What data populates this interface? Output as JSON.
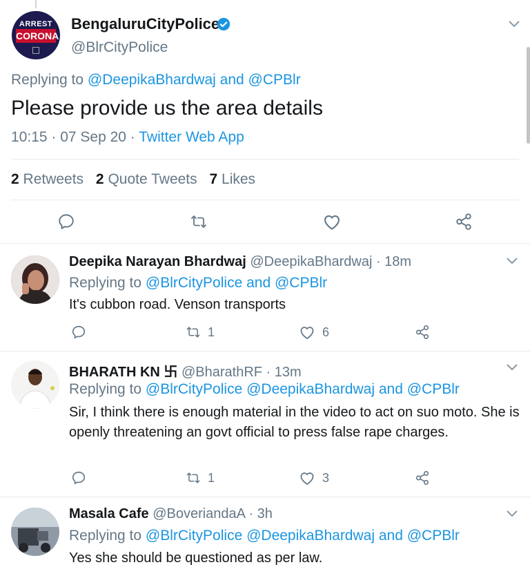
{
  "main_tweet": {
    "avatar": {
      "line1": "ARREST",
      "line2": "CORONA"
    },
    "name": "BengaluruCityPolice",
    "handle": "@BlrCityPolice",
    "replying_prefix": "Replying to",
    "replying_to": "@DeepikaBhardwaj and @CPBlr",
    "text": "Please provide us the area details",
    "time": "10:15 · 07 Sep 20 ·",
    "source": "Twitter Web App",
    "retweets_count": "2",
    "retweets_label": "Retweets",
    "quotes_count": "2",
    "quotes_label": "Quote Tweets",
    "likes_count": "7",
    "likes_label": "Likes"
  },
  "replies": [
    {
      "name": "Deepika Narayan Bhardwaj",
      "handle": "@DeepikaBhardwaj · 18m",
      "replying_prefix": "Replying to",
      "replying_to": "@BlrCityPolice and @CPBlr",
      "text": "It's cubbon road. Venson transports",
      "retweets": "1",
      "likes": "6"
    },
    {
      "name": "BHARATH KN 卐",
      "handle": "@BharathRF · 13m",
      "replying_prefix": "Replying to",
      "replying_to": "@BlrCityPolice @DeepikaBhardwaj and @CPBlr",
      "text": "Sir, I think there is enough material in the video to act on suo moto. She is openly threatening an govt official to press false rape charges.",
      "retweets": "1",
      "likes": "3"
    },
    {
      "name": "Masala Cafe",
      "handle": "@BoveriandaA · 3h",
      "replying_prefix": "Replying to",
      "replying_to": "@BlrCityPolice @DeepikaBhardwaj and @CPBlr",
      "text": "Yes she should be questioned as per law."
    }
  ],
  "colors": {
    "link": "#1b95e0",
    "muted": "#657786",
    "text": "#14171a"
  }
}
